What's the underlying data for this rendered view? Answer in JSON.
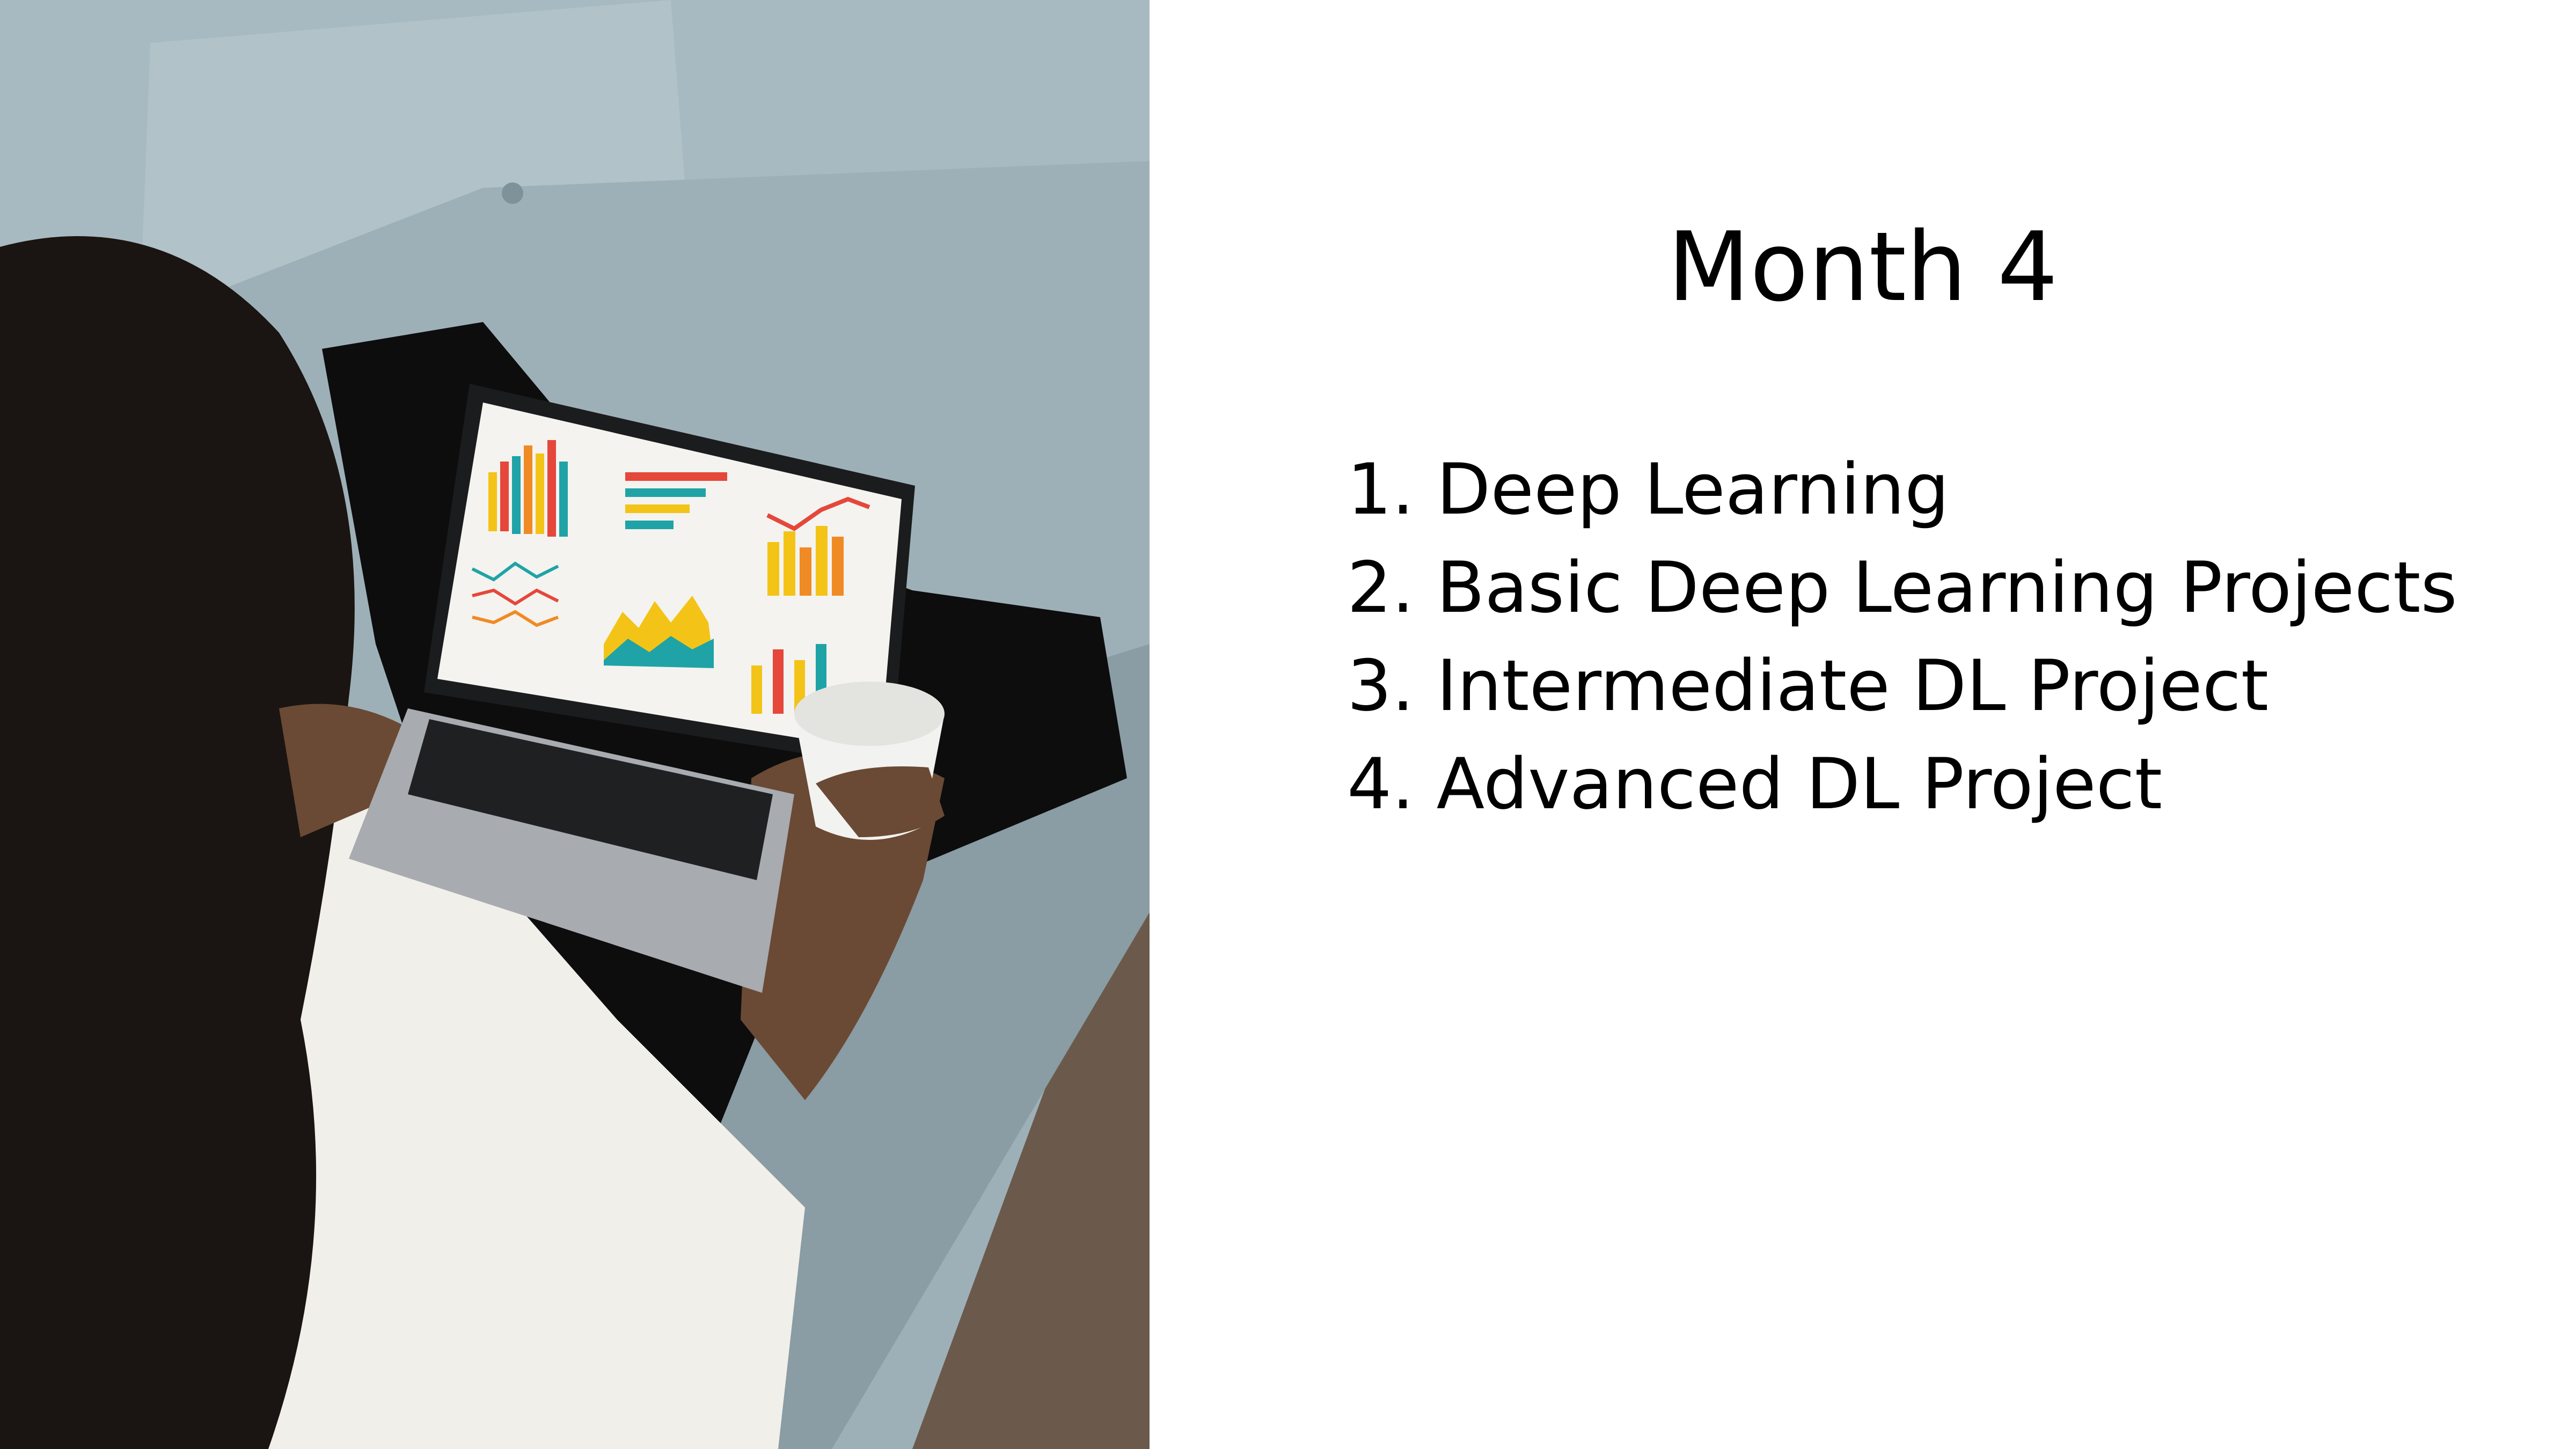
{
  "slide": {
    "title": "Month 4",
    "items": [
      "1. Deep Learning",
      "2. Basic Deep Learning Projects",
      "3. Intermediate DL Project",
      "4. Advanced DL Project"
    ]
  },
  "photo": {
    "subject": "person-on-sofa-with-laptop-showing-charts",
    "colors": {
      "sofa": "#9fb1b8",
      "sofa_shadow": "#7f9199",
      "floor": "#6b5a4c",
      "hair": "#1a1512",
      "shirt": "#f1efea",
      "pants": "#0d0d0e",
      "laptop": "#a8abb0",
      "screen": "#f4f3ef",
      "cup": "#f2f2f0",
      "chart_yellow": "#f3c417",
      "chart_teal": "#1fa3a6",
      "chart_red": "#e5473b",
      "chart_orange": "#f08a24"
    }
  }
}
